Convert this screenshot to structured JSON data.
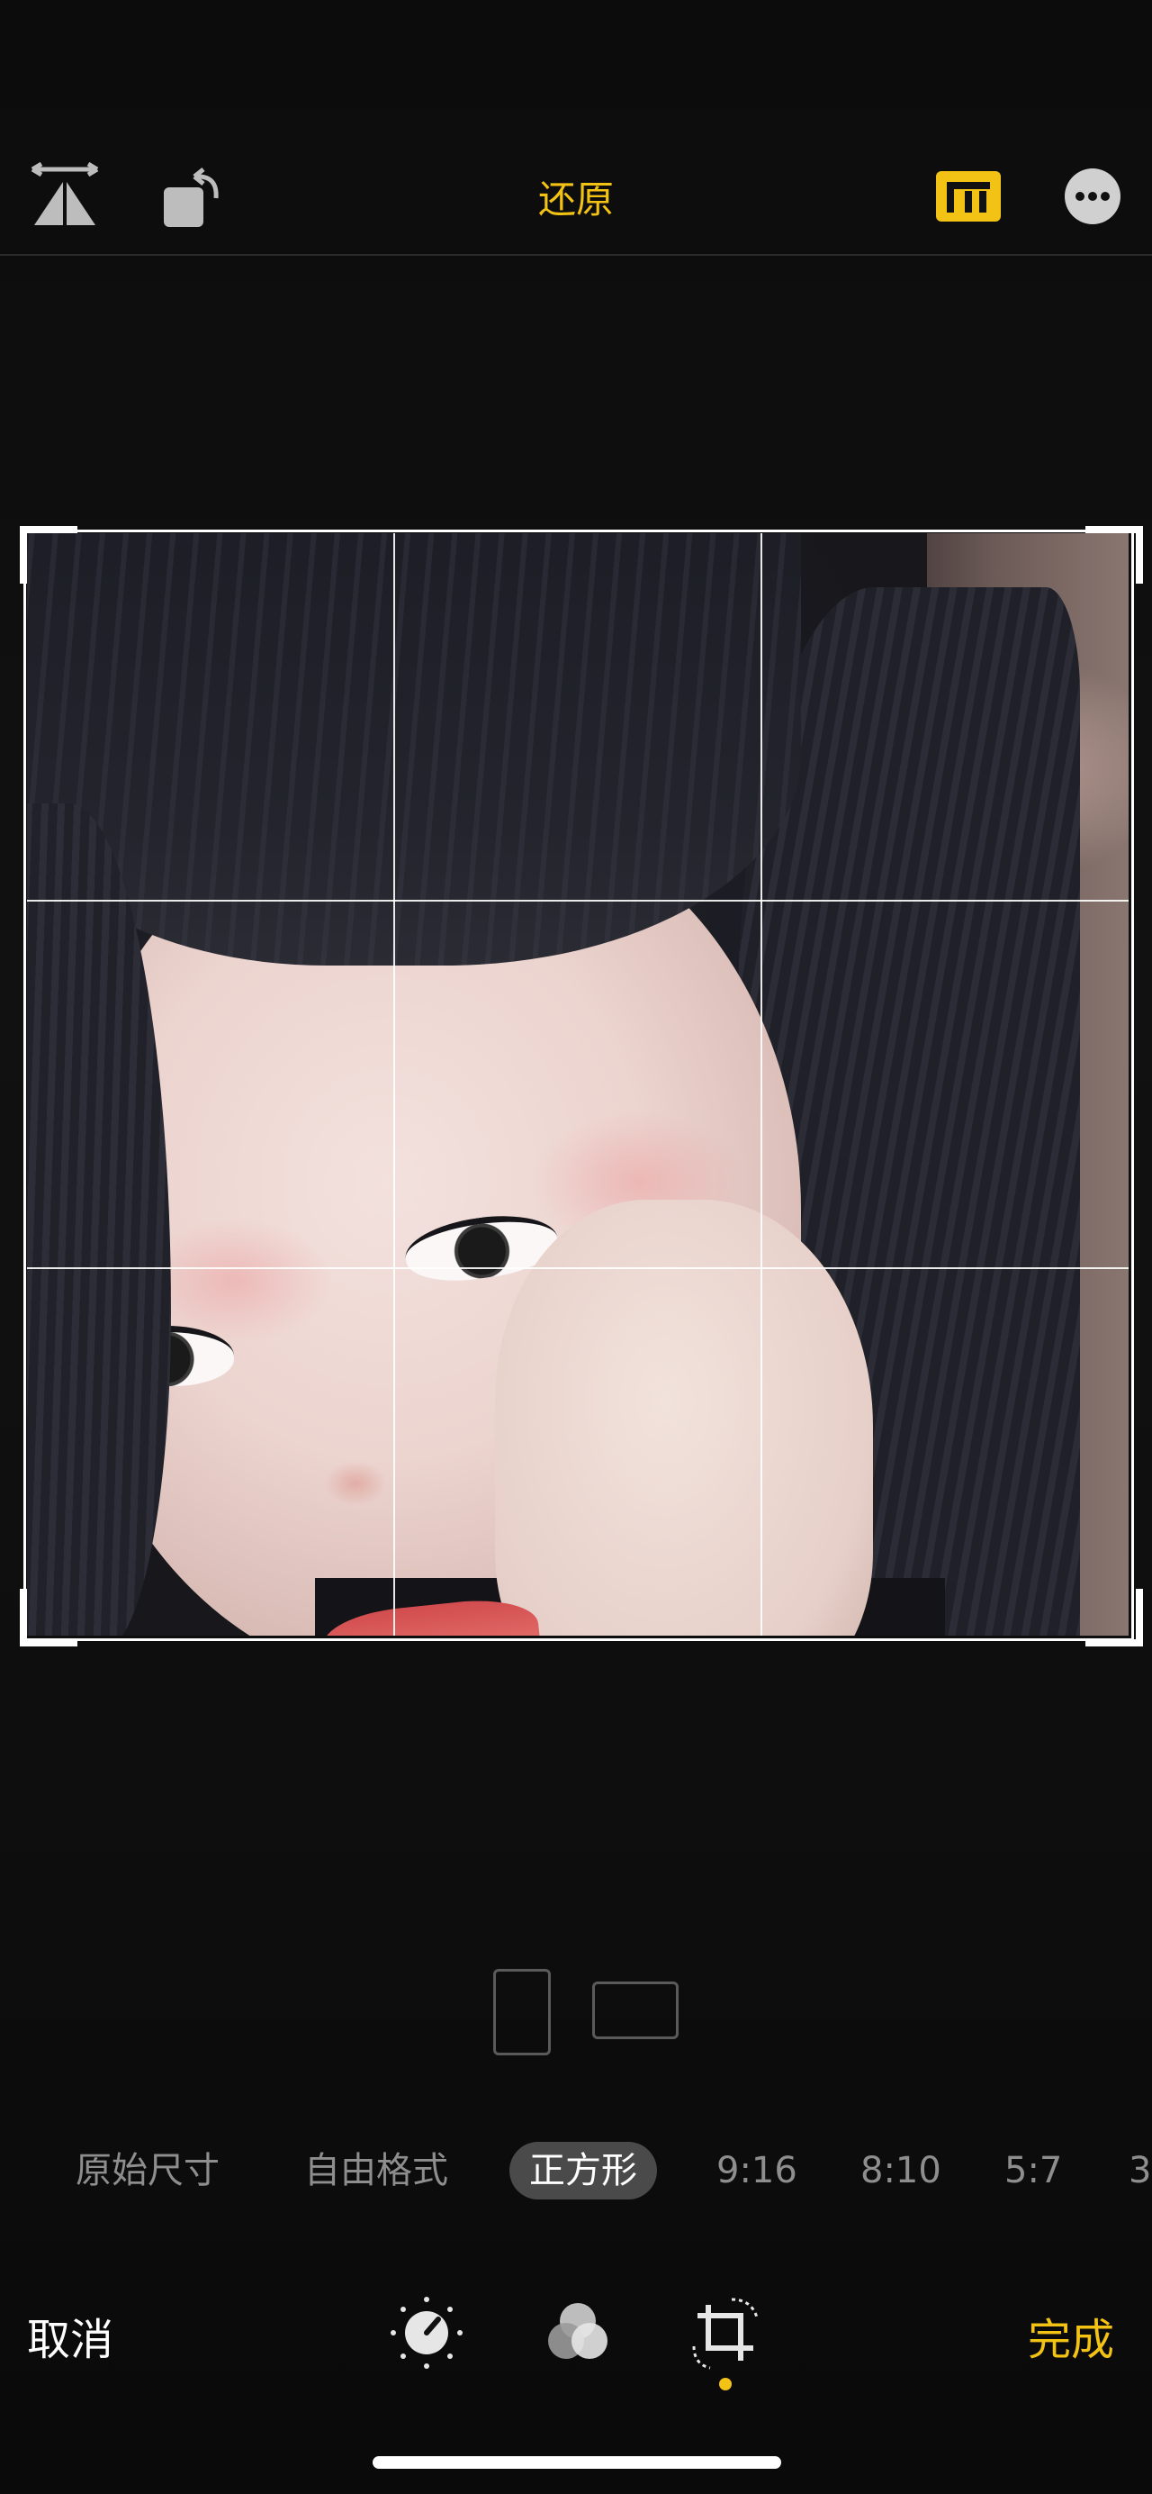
{
  "topbar": {
    "revert_label": "还原",
    "icons": [
      "perspective-flip-icon",
      "rotate-icon",
      "aspect-ratio-icon",
      "more-icon"
    ]
  },
  "orientation": {
    "options": [
      "portrait",
      "landscape"
    ]
  },
  "aspect_ratios": {
    "items": [
      "原始尺寸",
      "自由格式",
      "正方形",
      "9:16",
      "8:10",
      "5:7",
      "3"
    ],
    "selected": "正方形"
  },
  "bottombar": {
    "cancel_label": "取消",
    "done_label": "完成",
    "tools": [
      "adjust-icon",
      "filters-icon",
      "crop-icon"
    ],
    "active_tool": "crop-icon"
  },
  "colors": {
    "accent": "#f2c315",
    "background": "#0c0c0c",
    "selected_pill": "#4a4a4a",
    "inactive_text": "#8e8e8e"
  }
}
